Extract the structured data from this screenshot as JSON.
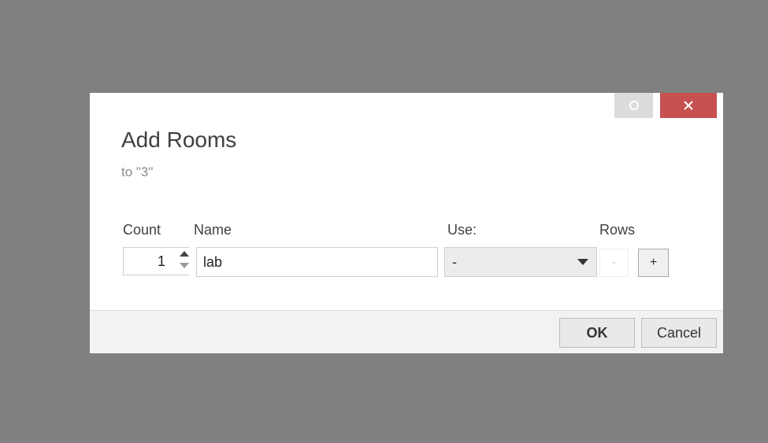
{
  "dialog": {
    "title": "Add Rooms",
    "subtitle": "to \"3\"",
    "colors": {
      "overlay": "#808080",
      "close_button": "#c75050",
      "restore_button": "#dcdcdc",
      "footer": "#f2f2f2"
    }
  },
  "titlebar": {
    "restore_icon": "circle-icon",
    "close_icon": "close-icon",
    "close_glyph": "✕"
  },
  "columns": {
    "count": "Count",
    "name": "Name",
    "use": "Use:",
    "rows": "Rows"
  },
  "row": {
    "count_value": "1",
    "name_value": "lab",
    "use_value": "-",
    "minus_label": "-",
    "plus_label": "+"
  },
  "footer": {
    "ok_label": "OK",
    "cancel_label": "Cancel"
  }
}
